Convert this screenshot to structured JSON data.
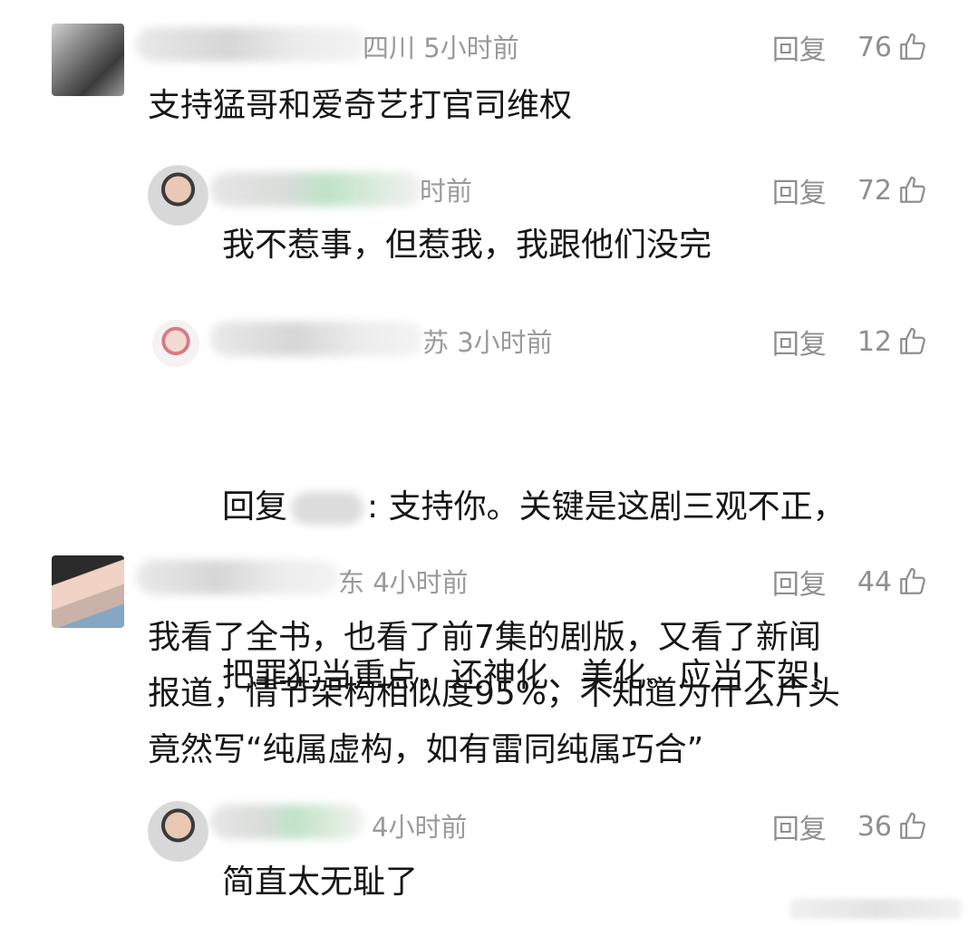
{
  "comments": [
    {
      "location_time": "四川 5小时前",
      "reply_label": "回复",
      "likes": "76",
      "text": "支持猛哥和爱奇艺打官司维权"
    },
    {
      "location_time": "时前",
      "reply_label": "回复",
      "likes": "72",
      "text": "我不惹事，但惹我，我跟他们没完"
    },
    {
      "location_time": "苏 3小时前",
      "reply_label": "回复",
      "likes": "12",
      "text_prefix": "回复",
      "text_line1": ": 支持你。关键是这剧三观不正，",
      "text_line2": "把罪犯当重点，还神化、美化。应当下架!"
    },
    {
      "location_time": "东 4小时前",
      "reply_label": "回复",
      "likes": "44",
      "text": "我看了全书，也看了前7集的剧版，又看了新闻\n报道，情节架构相似度95%，不知道为什么片头\n竟然写“纯属虚构，如有雷同纯属巧合”"
    },
    {
      "location_time": "4小时前",
      "reply_label": "回复",
      "likes": "36",
      "text": "简直太无耻了"
    }
  ],
  "icons": {
    "like": "thumbs-up-icon",
    "avatar": "avatar"
  },
  "colors": {
    "meta": "#9a9a9a",
    "text": "#161616",
    "blur_green": "#bfe3c9"
  }
}
